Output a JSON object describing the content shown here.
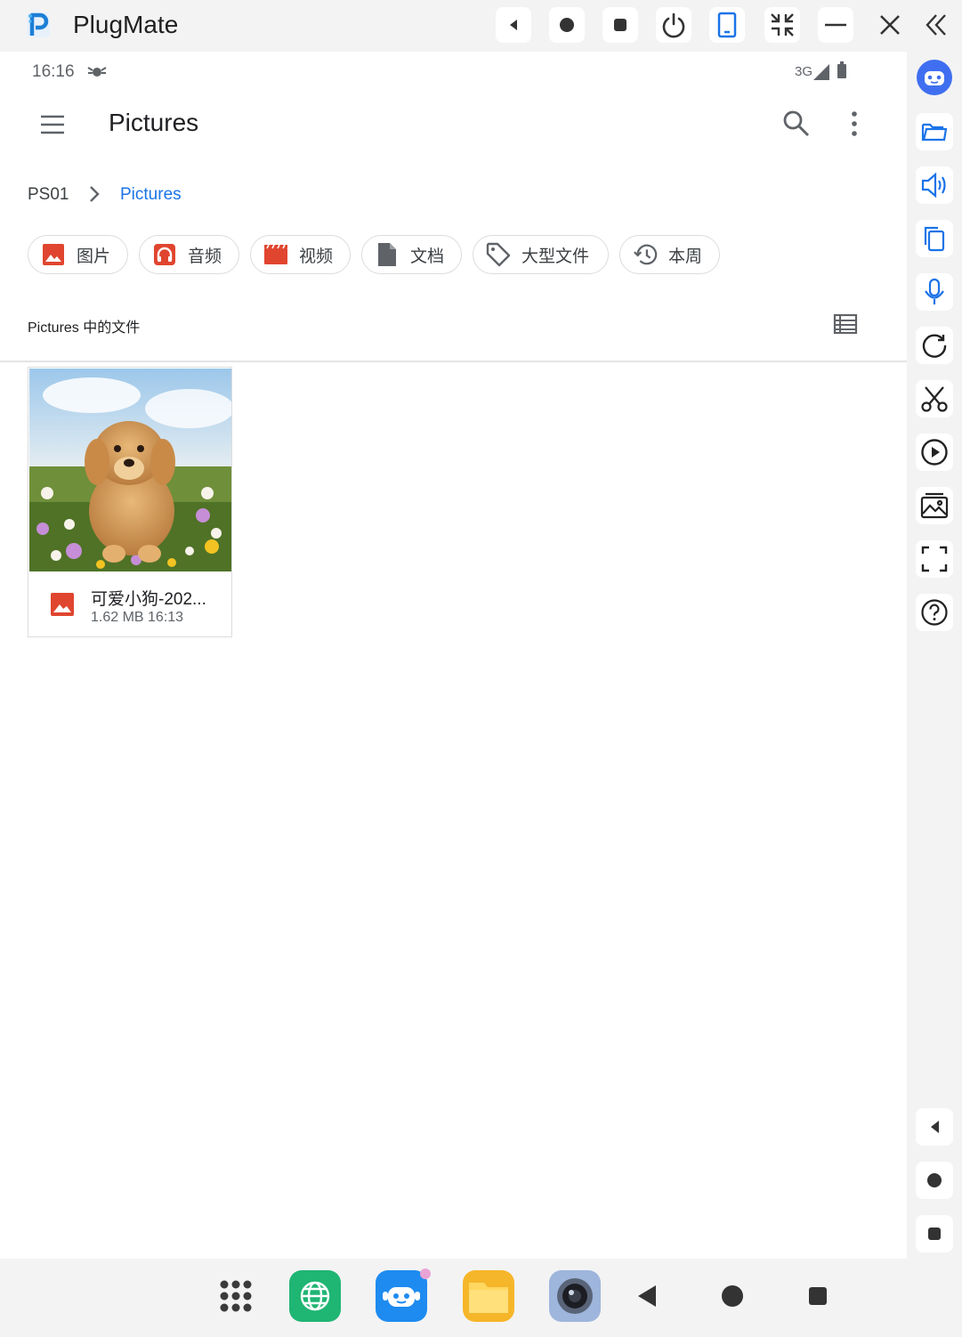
{
  "window": {
    "title": "PlugMate",
    "controls": [
      "back-icon",
      "home-icon",
      "recents-icon",
      "power-icon",
      "phone-icon",
      "shrink-icon",
      "minimize-icon",
      "close-icon",
      "collapse-icon"
    ]
  },
  "sidebar": {
    "tools": [
      "robot-icon",
      "folder-icon",
      "volume-icon",
      "copy-icon",
      "microphone-icon",
      "rotate-icon",
      "scissors-icon",
      "play-icon",
      "gallery-icon",
      "fullscreen-icon",
      "help-icon"
    ],
    "nav": [
      "back-icon",
      "home-icon",
      "recents-icon"
    ]
  },
  "status": {
    "time": "16:16",
    "network": "3G"
  },
  "appbar": {
    "title": "Pictures"
  },
  "breadcrumb": {
    "root": "PS01",
    "current": "Pictures"
  },
  "chips": [
    {
      "label": "图片",
      "icon": "image-icon"
    },
    {
      "label": "音频",
      "icon": "headphones-icon"
    },
    {
      "label": "视频",
      "icon": "video-icon"
    },
    {
      "label": "文档",
      "icon": "document-icon"
    },
    {
      "label": "大型文件",
      "icon": "tag-icon"
    },
    {
      "label": "本周",
      "icon": "history-icon"
    }
  ],
  "section": {
    "label": "Pictures 中的文件"
  },
  "files": [
    {
      "name": "可爱小狗-202...",
      "meta": "1.62 MB 16:13"
    }
  ],
  "taskbar": {
    "items": [
      "apps-grid-icon",
      "browser-icon",
      "robot-app-icon",
      "files-app-icon",
      "camera-app-icon",
      "back-icon",
      "home-icon",
      "recents-icon"
    ]
  },
  "colors": {
    "accent": "#1a73e8",
    "file_icon_red": "#e0452f",
    "chip_border": "#dadce0",
    "chrome_bg": "#f3f3f3"
  }
}
